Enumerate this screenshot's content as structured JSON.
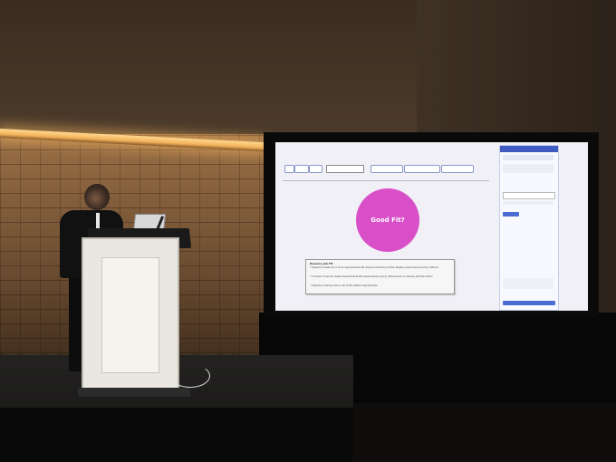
{
  "colors": {
    "wood": "#7b5737",
    "screen_bg": "#f1f0f6",
    "accent_pink": "#d84fc8",
    "sidebar_header": "#3f5bc2",
    "button_blue": "#4a6bd3"
  },
  "slide": {
    "circle_label": "Good Fit?",
    "fit_box": {
      "title": "Resume Job Fit",
      "options": [
        "Resume meets all or more requirements OR resume matches job title despite requirements poorly defined",
        "Unclear if resume meets requirements OR requirements poorly defined and no resume job title match",
        "Resume missing most or all of the stated requirements"
      ]
    }
  }
}
